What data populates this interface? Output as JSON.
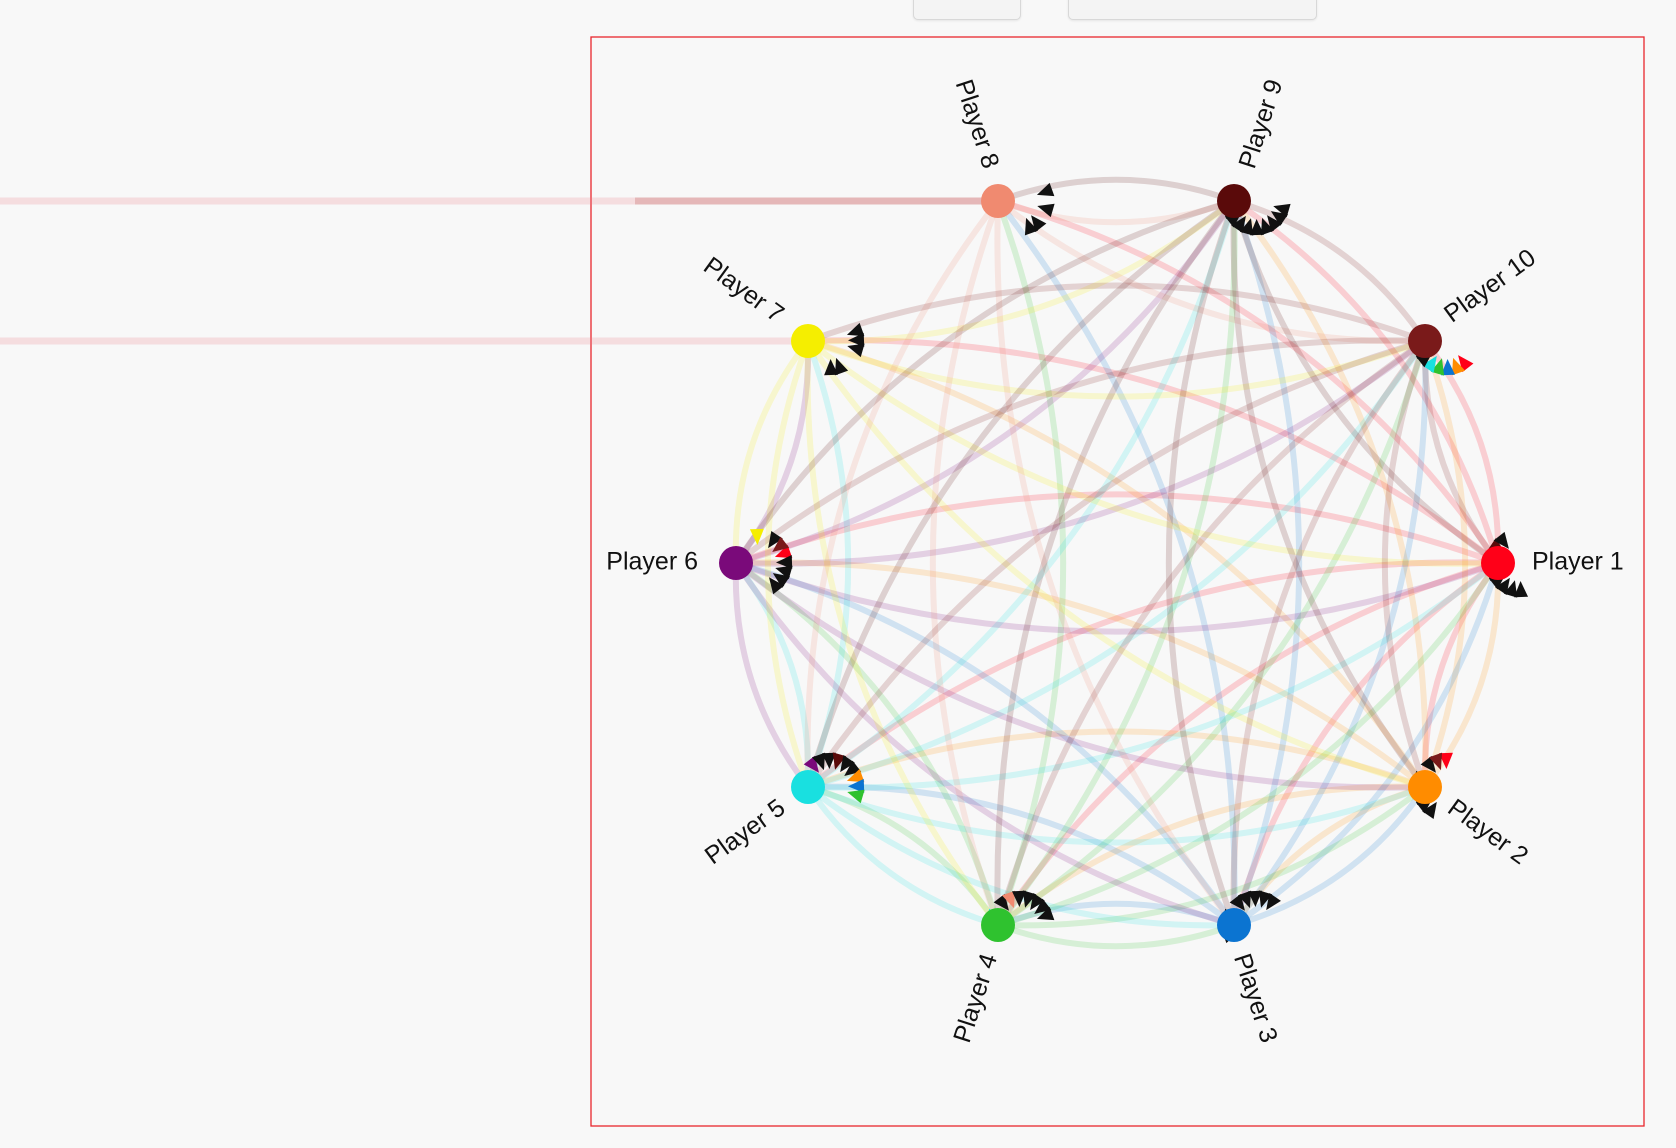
{
  "players": [
    {
      "id": 1,
      "name": "Player 1",
      "color": "#ff0018"
    },
    {
      "id": 2,
      "name": "Player 2",
      "color": "#ff8c00"
    },
    {
      "id": 3,
      "name": "Player 3",
      "color": "#0b74d1"
    },
    {
      "id": 4,
      "name": "Player 4",
      "color": "#2fc22f"
    },
    {
      "id": 5,
      "name": "Player 5",
      "color": "#19e0e0"
    },
    {
      "id": 6,
      "name": "Player 6",
      "color": "#7a0a7a"
    },
    {
      "id": 7,
      "name": "Player 7",
      "color": "#f5ee00"
    },
    {
      "id": 8,
      "name": "Player 8",
      "color": "#f08a70"
    },
    {
      "id": 9,
      "name": "Player 9",
      "color": "#5a0a0a"
    },
    {
      "id": 10,
      "name": "Player 10",
      "color": "#7a1a1a"
    }
  ],
  "edges": [
    [
      1,
      2
    ],
    [
      1,
      3
    ],
    [
      1,
      4
    ],
    [
      1,
      5
    ],
    [
      1,
      6
    ],
    [
      1,
      7
    ],
    [
      1,
      8
    ],
    [
      1,
      9
    ],
    [
      1,
      10
    ],
    [
      2,
      1
    ],
    [
      2,
      3
    ],
    [
      2,
      4
    ],
    [
      2,
      5
    ],
    [
      2,
      6
    ],
    [
      2,
      7
    ],
    [
      2,
      9
    ],
    [
      2,
      10
    ],
    [
      3,
      1
    ],
    [
      3,
      2
    ],
    [
      3,
      4
    ],
    [
      3,
      5
    ],
    [
      3,
      6
    ],
    [
      3,
      8
    ],
    [
      3,
      9
    ],
    [
      3,
      10
    ],
    [
      4,
      1
    ],
    [
      4,
      2
    ],
    [
      4,
      3
    ],
    [
      4,
      5
    ],
    [
      4,
      6
    ],
    [
      4,
      8
    ],
    [
      4,
      9
    ],
    [
      4,
      10
    ],
    [
      5,
      1
    ],
    [
      5,
      2
    ],
    [
      5,
      3
    ],
    [
      5,
      4
    ],
    [
      5,
      6
    ],
    [
      5,
      7
    ],
    [
      5,
      9
    ],
    [
      5,
      10
    ],
    [
      6,
      1
    ],
    [
      6,
      2
    ],
    [
      6,
      3
    ],
    [
      6,
      5
    ],
    [
      6,
      7
    ],
    [
      6,
      9
    ],
    [
      6,
      10
    ],
    [
      7,
      1
    ],
    [
      7,
      2
    ],
    [
      7,
      4
    ],
    [
      7,
      5
    ],
    [
      7,
      6
    ],
    [
      7,
      9
    ],
    [
      7,
      10
    ],
    [
      8,
      3
    ],
    [
      8,
      4
    ],
    [
      8,
      5
    ],
    [
      8,
      9
    ],
    [
      8,
      10
    ],
    [
      9,
      1
    ],
    [
      9,
      2
    ],
    [
      9,
      3
    ],
    [
      9,
      4
    ],
    [
      9,
      5
    ],
    [
      9,
      6
    ],
    [
      9,
      8
    ],
    [
      10,
      1
    ],
    [
      10,
      2
    ],
    [
      10,
      3
    ],
    [
      10,
      4
    ],
    [
      10,
      5
    ],
    [
      10,
      6
    ],
    [
      10,
      7
    ],
    [
      10,
      9
    ]
  ]
}
